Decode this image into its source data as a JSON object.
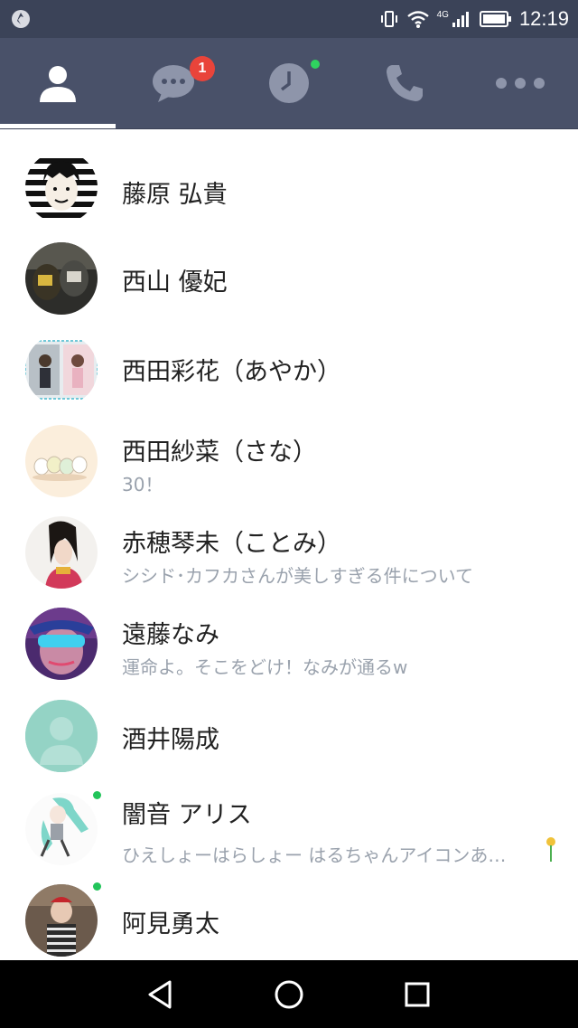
{
  "status_bar": {
    "time": "12:19",
    "network": "4G",
    "left_icon": "app-notification-icon"
  },
  "tabs": [
    {
      "name": "friends",
      "icon": "person-icon",
      "active": true
    },
    {
      "name": "chats",
      "icon": "chat-bubble-icon",
      "badge": "1"
    },
    {
      "name": "timeline",
      "icon": "clock-icon",
      "dot": true
    },
    {
      "name": "calls",
      "icon": "phone-icon"
    },
    {
      "name": "more",
      "icon": "more-dots-icon"
    }
  ],
  "contacts": [
    {
      "name": "藤原 弘貴",
      "status": ""
    },
    {
      "name": "西山 優妃",
      "status": ""
    },
    {
      "name": "西田彩花（あやか）",
      "status": ""
    },
    {
      "name": "西田紗菜（さな）",
      "status": "30！"
    },
    {
      "name": "赤穂琴未（ことみ）",
      "status": "シシド･カフカさんが美しすぎる件について"
    },
    {
      "name": "遠藤なみ",
      "status": "運命よ。そこをどけ！なみが通るw"
    },
    {
      "name": "酒井陽成",
      "status": ""
    },
    {
      "name": "闇音 アリス",
      "status": "ひえしょーはらしょー はるちゃんアイコンあ…",
      "online": true
    },
    {
      "name": "阿見勇太",
      "status": "",
      "online": true
    }
  ],
  "colors": {
    "header": "#495169",
    "status_bar": "#3b4358",
    "badge": "#e9443a",
    "online": "#22c45a"
  }
}
